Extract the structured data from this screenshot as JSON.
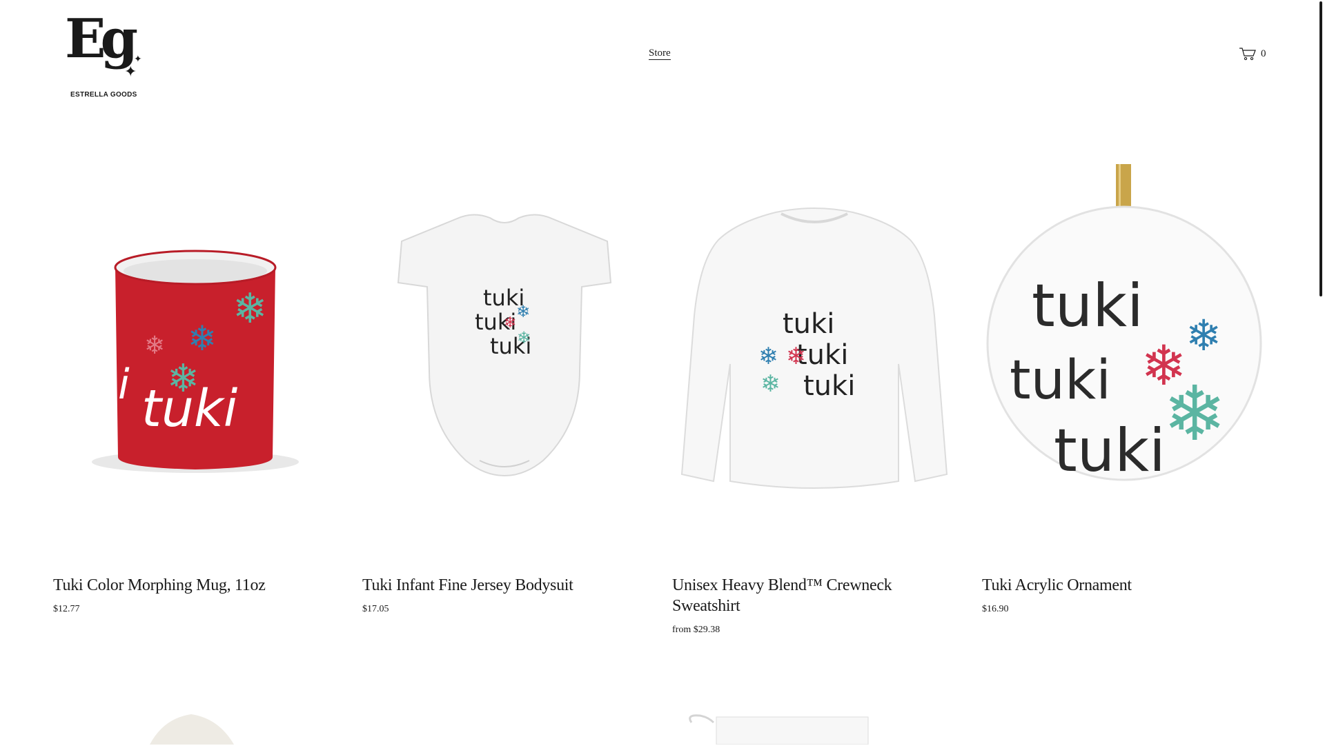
{
  "brand": {
    "monogram": "Eg",
    "name": "ESTRELLA GOODS"
  },
  "nav": {
    "store_label": "Store"
  },
  "cart": {
    "count": "0"
  },
  "products": [
    {
      "title": "Tuki Color Morphing Mug, 11oz",
      "price": "$12.77",
      "print": "tuki"
    },
    {
      "title": "Tuki Infant Fine Jersey Bodysuit",
      "price": "$17.05",
      "print": [
        "tuki",
        "tuki",
        "tuki"
      ]
    },
    {
      "title": "Unisex Heavy Blend™ Crewneck Sweatshirt",
      "price": "from $29.38",
      "print": [
        "tuki",
        "tuki",
        "tuki"
      ]
    },
    {
      "title": "Tuki Acrylic Ornament",
      "price": "$16.90",
      "print": [
        "tuki",
        "tuki",
        "tuki"
      ]
    }
  ],
  "colors": {
    "text": "#1a1a1a",
    "mug_red": "#c8202c",
    "flake_blue": "#2f7fb0",
    "flake_pink": "#d2344f",
    "flake_teal": "#5bb5a2",
    "ribbon_gold": "#c9a54a"
  }
}
